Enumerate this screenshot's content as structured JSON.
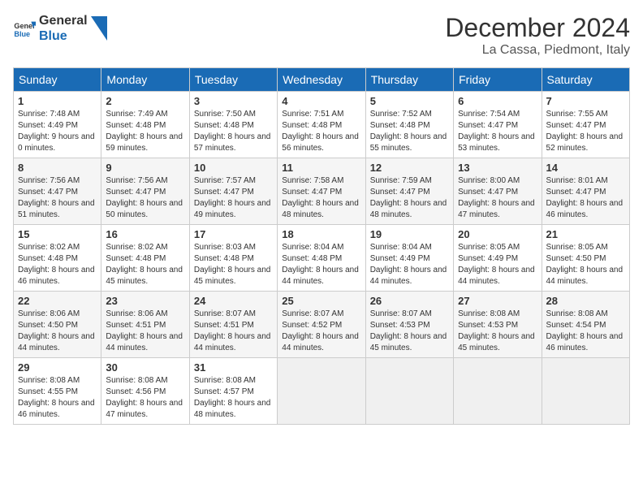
{
  "header": {
    "logo_line1": "General",
    "logo_line2": "Blue",
    "month_title": "December 2024",
    "location": "La Cassa, Piedmont, Italy"
  },
  "days_of_week": [
    "Sunday",
    "Monday",
    "Tuesday",
    "Wednesday",
    "Thursday",
    "Friday",
    "Saturday"
  ],
  "weeks": [
    [
      {
        "day": "1",
        "sunrise": "7:48 AM",
        "sunset": "4:49 PM",
        "daylight": "9 hours and 0 minutes."
      },
      {
        "day": "2",
        "sunrise": "7:49 AM",
        "sunset": "4:48 PM",
        "daylight": "8 hours and 59 minutes."
      },
      {
        "day": "3",
        "sunrise": "7:50 AM",
        "sunset": "4:48 PM",
        "daylight": "8 hours and 57 minutes."
      },
      {
        "day": "4",
        "sunrise": "7:51 AM",
        "sunset": "4:48 PM",
        "daylight": "8 hours and 56 minutes."
      },
      {
        "day": "5",
        "sunrise": "7:52 AM",
        "sunset": "4:48 PM",
        "daylight": "8 hours and 55 minutes."
      },
      {
        "day": "6",
        "sunrise": "7:54 AM",
        "sunset": "4:47 PM",
        "daylight": "8 hours and 53 minutes."
      },
      {
        "day": "7",
        "sunrise": "7:55 AM",
        "sunset": "4:47 PM",
        "daylight": "8 hours and 52 minutes."
      }
    ],
    [
      {
        "day": "8",
        "sunrise": "7:56 AM",
        "sunset": "4:47 PM",
        "daylight": "8 hours and 51 minutes."
      },
      {
        "day": "9",
        "sunrise": "7:56 AM",
        "sunset": "4:47 PM",
        "daylight": "8 hours and 50 minutes."
      },
      {
        "day": "10",
        "sunrise": "7:57 AM",
        "sunset": "4:47 PM",
        "daylight": "8 hours and 49 minutes."
      },
      {
        "day": "11",
        "sunrise": "7:58 AM",
        "sunset": "4:47 PM",
        "daylight": "8 hours and 48 minutes."
      },
      {
        "day": "12",
        "sunrise": "7:59 AM",
        "sunset": "4:47 PM",
        "daylight": "8 hours and 48 minutes."
      },
      {
        "day": "13",
        "sunrise": "8:00 AM",
        "sunset": "4:47 PM",
        "daylight": "8 hours and 47 minutes."
      },
      {
        "day": "14",
        "sunrise": "8:01 AM",
        "sunset": "4:47 PM",
        "daylight": "8 hours and 46 minutes."
      }
    ],
    [
      {
        "day": "15",
        "sunrise": "8:02 AM",
        "sunset": "4:48 PM",
        "daylight": "8 hours and 46 minutes."
      },
      {
        "day": "16",
        "sunrise": "8:02 AM",
        "sunset": "4:48 PM",
        "daylight": "8 hours and 45 minutes."
      },
      {
        "day": "17",
        "sunrise": "8:03 AM",
        "sunset": "4:48 PM",
        "daylight": "8 hours and 45 minutes."
      },
      {
        "day": "18",
        "sunrise": "8:04 AM",
        "sunset": "4:48 PM",
        "daylight": "8 hours and 44 minutes."
      },
      {
        "day": "19",
        "sunrise": "8:04 AM",
        "sunset": "4:49 PM",
        "daylight": "8 hours and 44 minutes."
      },
      {
        "day": "20",
        "sunrise": "8:05 AM",
        "sunset": "4:49 PM",
        "daylight": "8 hours and 44 minutes."
      },
      {
        "day": "21",
        "sunrise": "8:05 AM",
        "sunset": "4:50 PM",
        "daylight": "8 hours and 44 minutes."
      }
    ],
    [
      {
        "day": "22",
        "sunrise": "8:06 AM",
        "sunset": "4:50 PM",
        "daylight": "8 hours and 44 minutes."
      },
      {
        "day": "23",
        "sunrise": "8:06 AM",
        "sunset": "4:51 PM",
        "daylight": "8 hours and 44 minutes."
      },
      {
        "day": "24",
        "sunrise": "8:07 AM",
        "sunset": "4:51 PM",
        "daylight": "8 hours and 44 minutes."
      },
      {
        "day": "25",
        "sunrise": "8:07 AM",
        "sunset": "4:52 PM",
        "daylight": "8 hours and 44 minutes."
      },
      {
        "day": "26",
        "sunrise": "8:07 AM",
        "sunset": "4:53 PM",
        "daylight": "8 hours and 45 minutes."
      },
      {
        "day": "27",
        "sunrise": "8:08 AM",
        "sunset": "4:53 PM",
        "daylight": "8 hours and 45 minutes."
      },
      {
        "day": "28",
        "sunrise": "8:08 AM",
        "sunset": "4:54 PM",
        "daylight": "8 hours and 46 minutes."
      }
    ],
    [
      {
        "day": "29",
        "sunrise": "8:08 AM",
        "sunset": "4:55 PM",
        "daylight": "8 hours and 46 minutes."
      },
      {
        "day": "30",
        "sunrise": "8:08 AM",
        "sunset": "4:56 PM",
        "daylight": "8 hours and 47 minutes."
      },
      {
        "day": "31",
        "sunrise": "8:08 AM",
        "sunset": "4:57 PM",
        "daylight": "8 hours and 48 minutes."
      },
      null,
      null,
      null,
      null
    ]
  ],
  "labels": {
    "sunrise": "Sunrise:",
    "sunset": "Sunset:",
    "daylight": "Daylight:"
  }
}
